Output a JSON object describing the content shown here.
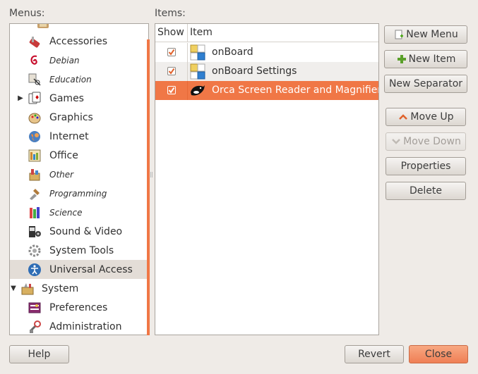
{
  "labels": {
    "menus": "Menus:",
    "items": "Items:"
  },
  "menus": {
    "items": [
      {
        "label": "Accessories",
        "italic": false,
        "icon": "accessories-icon"
      },
      {
        "label": "Debian",
        "italic": true,
        "icon": "debian-icon"
      },
      {
        "label": "Education",
        "italic": true,
        "icon": "education-icon"
      },
      {
        "label": "Games",
        "italic": false,
        "icon": "games-icon"
      },
      {
        "label": "Graphics",
        "italic": false,
        "icon": "graphics-icon"
      },
      {
        "label": "Internet",
        "italic": false,
        "icon": "internet-icon"
      },
      {
        "label": "Office",
        "italic": false,
        "icon": "office-icon"
      },
      {
        "label": "Other",
        "italic": true,
        "icon": "other-icon"
      },
      {
        "label": "Programming",
        "italic": true,
        "icon": "programming-icon"
      },
      {
        "label": "Science",
        "italic": true,
        "icon": "science-icon"
      },
      {
        "label": "Sound & Video",
        "italic": false,
        "icon": "sound-video-icon"
      },
      {
        "label": "System Tools",
        "italic": false,
        "icon": "system-tools-icon"
      },
      {
        "label": "Universal Access",
        "italic": false,
        "icon": "universal-access-icon"
      },
      {
        "label": "System",
        "italic": false,
        "icon": "system-icon"
      },
      {
        "label": "Preferences",
        "italic": false,
        "icon": "preferences-icon"
      },
      {
        "label": "Administration",
        "italic": false,
        "icon": "administration-icon"
      }
    ],
    "selected": "Universal Access"
  },
  "items": {
    "columns": {
      "show": "Show",
      "item": "Item"
    },
    "rows": [
      {
        "label": "onBoard",
        "checked": true,
        "icon": "onboard-icon"
      },
      {
        "label": "onBoard Settings",
        "checked": true,
        "icon": "onboard-settings-icon"
      },
      {
        "label": "Orca Screen Reader and Magnifier",
        "checked": true,
        "icon": "orca-icon"
      }
    ]
  },
  "buttons": {
    "new_menu": "New Menu",
    "new_item": "New Item",
    "new_separator": "New Separator",
    "move_up": "Move Up",
    "move_down": "Move Down",
    "properties": "Properties",
    "delete": "Delete",
    "help": "Help",
    "revert": "Revert",
    "close": "Close"
  },
  "colors": {
    "accent": "#f07746",
    "window_bg": "#efebe7",
    "selected_row": "#e3ddd7"
  }
}
